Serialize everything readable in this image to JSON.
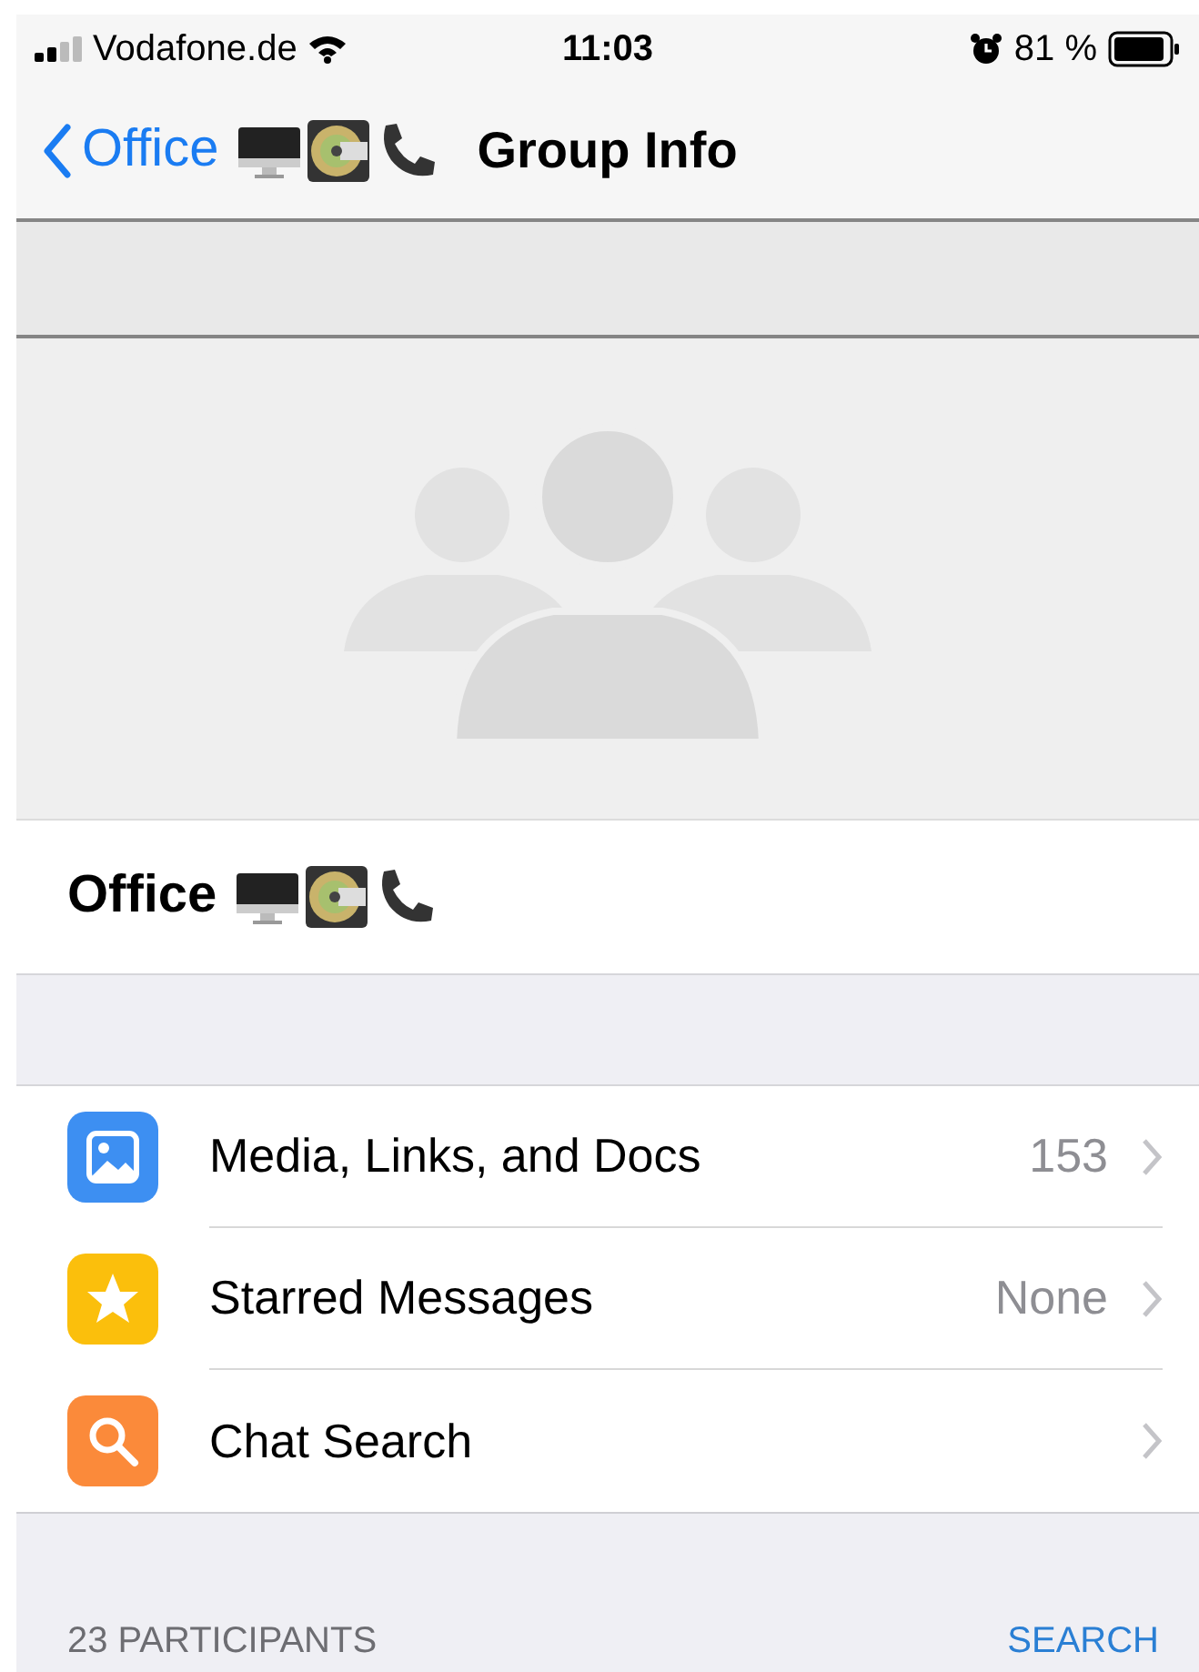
{
  "status_bar": {
    "carrier": "Vodafone.de",
    "time": "11:03",
    "battery": "81 %"
  },
  "nav": {
    "back": "Office",
    "title": "Group Info"
  },
  "group": {
    "name": "Office"
  },
  "rows": [
    {
      "kind": "media",
      "label": "Media, Links, and Docs",
      "value": "153"
    },
    {
      "kind": "starred",
      "label": "Starred Messages",
      "value": "None"
    },
    {
      "kind": "search",
      "label": "Chat Search"
    }
  ],
  "participants": {
    "count": "23 PARTICIPANTS",
    "action": "SEARCH"
  }
}
